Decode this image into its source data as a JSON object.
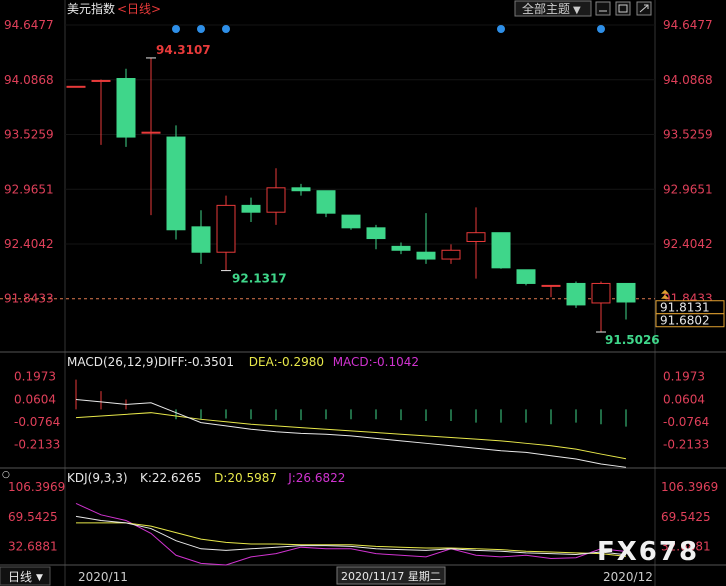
{
  "header": {
    "instrument": "美元指数",
    "period_tag": "<日线>",
    "theme_button": "全部主题",
    "chevron": "▼"
  },
  "colors": {
    "up": "#e83a3a",
    "down": "#3fd68a",
    "axis_text": "#e0405a",
    "grid": "#333333",
    "current_line": "#e07a50",
    "white": "#e8e8e8",
    "yellow": "#e8e84a",
    "magenta": "#d033d0",
    "dot": "#2e8fe8"
  },
  "chart_data": [
    {
      "type": "candlestick",
      "title": "美元指数",
      "period": "日线",
      "y_axis_ticks": [
        "94.6477",
        "94.0868",
        "93.5259",
        "92.9651",
        "92.4042",
        "91.8433"
      ],
      "ylim": [
        91.4,
        94.72
      ],
      "current_price": 91.8433,
      "price_boxes": [
        "91.8131",
        "91.6802"
      ],
      "annotations": {
        "high": "94.3107",
        "low_mid": "92.1317",
        "low_last": "91.5026"
      },
      "candles": [
        {
          "o": 94.02,
          "h": 94.02,
          "l": 94.02,
          "c": 94.02
        },
        {
          "o": 94.08,
          "h": 94.09,
          "l": 93.42,
          "c": 94.08
        },
        {
          "o": 94.1,
          "h": 94.2,
          "l": 93.4,
          "c": 93.5
        },
        {
          "o": 93.55,
          "h": 94.3107,
          "l": 92.7,
          "c": 93.55
        },
        {
          "o": 93.5,
          "h": 93.62,
          "l": 92.45,
          "c": 92.55
        },
        {
          "o": 92.58,
          "h": 92.75,
          "l": 92.2,
          "c": 92.32
        },
        {
          "o": 92.32,
          "h": 92.9,
          "l": 92.1317,
          "c": 92.8
        },
        {
          "o": 92.8,
          "h": 92.88,
          "l": 92.63,
          "c": 92.73
        },
        {
          "o": 92.73,
          "h": 93.18,
          "l": 92.6,
          "c": 92.98
        },
        {
          "o": 92.98,
          "h": 93.02,
          "l": 92.9,
          "c": 92.95
        },
        {
          "o": 92.95,
          "h": 92.95,
          "l": 92.68,
          "c": 92.72
        },
        {
          "o": 92.7,
          "h": 92.7,
          "l": 92.55,
          "c": 92.57
        },
        {
          "o": 92.57,
          "h": 92.6,
          "l": 92.35,
          "c": 92.46
        },
        {
          "o": 92.38,
          "h": 92.42,
          "l": 92.3,
          "c": 92.34
        },
        {
          "o": 92.32,
          "h": 92.72,
          "l": 92.2,
          "c": 92.25
        },
        {
          "o": 92.25,
          "h": 92.4,
          "l": 92.2,
          "c": 92.34
        },
        {
          "o": 92.43,
          "h": 92.78,
          "l": 92.05,
          "c": 92.52
        },
        {
          "o": 92.52,
          "h": 92.52,
          "l": 92.15,
          "c": 92.16
        },
        {
          "o": 92.14,
          "h": 92.14,
          "l": 91.98,
          "c": 92.0
        },
        {
          "o": 91.98,
          "h": 91.98,
          "l": 91.86,
          "c": 91.98
        },
        {
          "o": 92.0,
          "h": 92.02,
          "l": 91.75,
          "c": 91.78
        },
        {
          "o": 91.8,
          "h": 92.02,
          "l": 91.5026,
          "c": 92.0
        },
        {
          "o": 92.0,
          "h": 92.0,
          "l": 91.63,
          "c": 91.81
        }
      ],
      "dot_markers_at_candle": [
        4,
        5,
        6,
        17,
        21
      ]
    },
    {
      "type": "line",
      "title": "MACD(26,12,9)",
      "legend": [
        {
          "label": "DIFF:-0.3501",
          "color": "#e8e8e8"
        },
        {
          "label": "DEA:-0.2980",
          "color": "#e8e84a"
        },
        {
          "label": "MACD:-0.1042",
          "color": "#d033d0"
        }
      ],
      "y_axis_ticks": [
        "0.1973",
        "0.0604",
        "-0.0764",
        "-0.2133"
      ],
      "ylim": [
        -0.33,
        0.25
      ],
      "diff": [
        0.06,
        0.045,
        0.03,
        0.04,
        -0.02,
        -0.08,
        -0.1,
        -0.12,
        -0.135,
        -0.145,
        -0.15,
        -0.16,
        -0.175,
        -0.19,
        -0.205,
        -0.22,
        -0.235,
        -0.25,
        -0.26,
        -0.28,
        -0.3,
        -0.33,
        -0.35
      ],
      "dea": [
        -0.05,
        -0.04,
        -0.03,
        -0.02,
        -0.04,
        -0.06,
        -0.075,
        -0.09,
        -0.1,
        -0.11,
        -0.12,
        -0.13,
        -0.14,
        -0.15,
        -0.16,
        -0.17,
        -0.18,
        -0.19,
        -0.205,
        -0.22,
        -0.24,
        -0.27,
        -0.298
      ],
      "hist": [
        0.18,
        0.11,
        0.06,
        0.0,
        -0.06,
        -0.06,
        -0.055,
        -0.06,
        -0.065,
        -0.065,
        -0.06,
        -0.06,
        -0.06,
        -0.065,
        -0.07,
        -0.07,
        -0.08,
        -0.08,
        -0.08,
        -0.09,
        -0.08,
        -0.09,
        -0.104
      ]
    },
    {
      "type": "line",
      "title": "KDJ(9,3,3)",
      "legend": [
        {
          "label": "K:22.6265",
          "color": "#e8e8e8"
        },
        {
          "label": "D:20.5987",
          "color": "#e8e84a"
        },
        {
          "label": "J:26.6822",
          "color": "#d033d0"
        }
      ],
      "y_axis_ticks": [
        "106.3969",
        "69.5425",
        "32.6881"
      ],
      "ylim": [
        10,
        115
      ],
      "k": [
        70,
        65,
        62,
        55,
        40,
        30,
        28,
        30,
        32,
        34,
        34,
        33,
        30,
        29,
        28,
        30,
        28,
        27,
        25,
        24,
        23,
        26,
        22.6
      ],
      "d": [
        62,
        62,
        62,
        58,
        50,
        42,
        38,
        36,
        36,
        35,
        35,
        35,
        33,
        32,
        31,
        31,
        30,
        29,
        27,
        26,
        25,
        24,
        20.6
      ],
      "j": [
        86,
        72,
        65,
        49,
        22,
        12,
        10,
        20,
        24,
        32,
        30,
        30,
        24,
        22,
        20,
        30,
        22,
        20,
        22,
        18,
        19,
        30,
        26.7
      ]
    }
  ],
  "x_axis": {
    "labels": [
      "2020/11",
      "2020/12"
    ],
    "cursor_label": "2020/11/17 星期二"
  },
  "footer": {
    "period_button": "日线",
    "left_marker": "○"
  },
  "watermark": "FX678"
}
